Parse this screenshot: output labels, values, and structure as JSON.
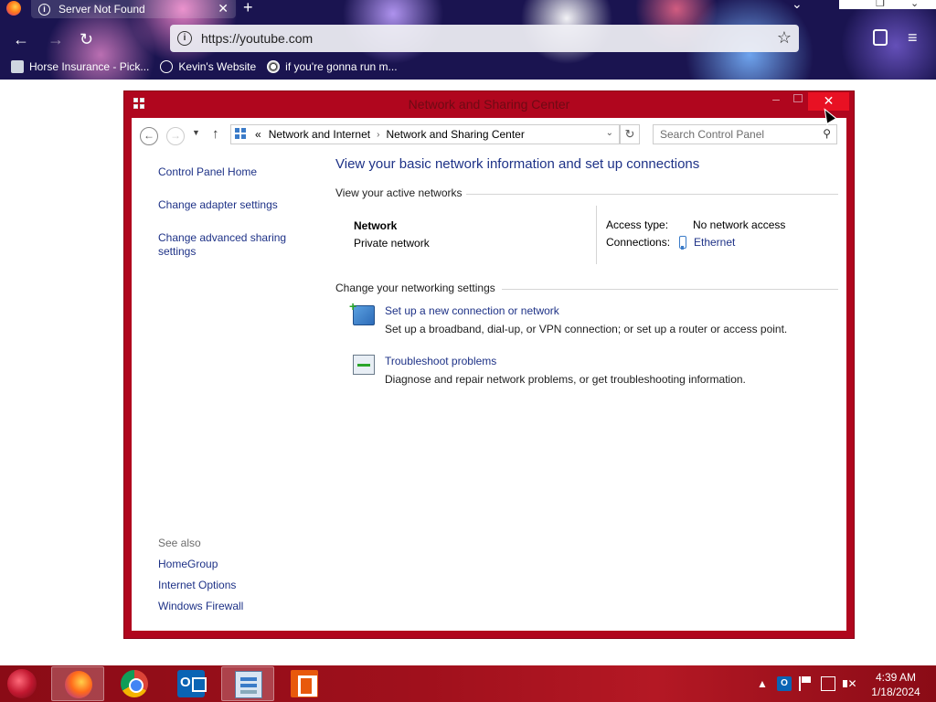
{
  "browser": {
    "tab": {
      "title": "Server Not Found",
      "close_glyph": "✕"
    },
    "new_tab_glyph": "+",
    "url": "https://youtube.com",
    "bookmarks": [
      {
        "label": "Horse Insurance - Pick..."
      },
      {
        "label": "Kevin's Website"
      },
      {
        "label": "if you're gonna run m..."
      }
    ]
  },
  "window": {
    "title": "Network and Sharing Center",
    "close_glyph": "✕"
  },
  "address_bar": {
    "overflow": "«",
    "breadcrumb": [
      "Network and Internet",
      "Network and Sharing Center"
    ],
    "separator": "›",
    "search_placeholder": "Search Control Panel"
  },
  "left_pane": {
    "links": [
      "Control Panel Home",
      "Change adapter settings",
      "Change advanced sharing settings"
    ],
    "see_also_title": "See also",
    "see_also": [
      "HomeGroup",
      "Internet Options",
      "Windows Firewall"
    ]
  },
  "main": {
    "title": "View your basic network information and set up connections",
    "active_networks_heading": "View your active networks",
    "network": {
      "name": "Network",
      "category": "Private network",
      "access_type_label": "Access type:",
      "access_type_value": "No network access",
      "connections_label": "Connections:",
      "connection": "Ethernet"
    },
    "settings_heading": "Change your networking settings",
    "tasks": [
      {
        "link": "Set up a new connection or network",
        "desc": "Set up a broadband, dial-up, or VPN connection; or set up a router or access point.",
        "icon": "network-setup-icon"
      },
      {
        "link": "Troubleshoot problems",
        "desc": "Diagnose and repair network problems, or get troubleshooting information.",
        "icon": "troubleshoot-icon"
      }
    ]
  },
  "taskbar": {
    "apps": [
      "firefox-icon",
      "chrome-icon",
      "outlook-icon",
      "control-panel-icon",
      "office-icon"
    ],
    "active_apps": [
      "firefox-icon",
      "control-panel-icon"
    ],
    "time": "4:39 AM",
    "date": "1/18/2024"
  },
  "colors": {
    "window_border": "#b0061e",
    "close_button": "#e81123",
    "link": "#1e3287",
    "taskbar": "#a0101c"
  }
}
